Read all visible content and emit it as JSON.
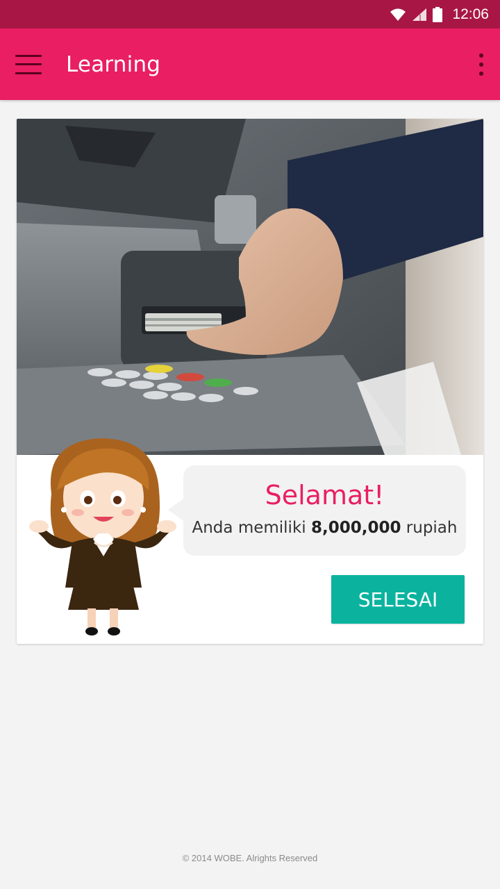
{
  "status_bar": {
    "time": "12:06",
    "icons": [
      "wifi-icon",
      "signal-icon",
      "battery-icon"
    ]
  },
  "app_bar": {
    "title": "Learning",
    "menu_icon": "hamburger-menu-icon",
    "overflow_icon": "more-vert-icon"
  },
  "card": {
    "hero_image": "atm-cash-withdrawal-photo",
    "character_image": "cartoon-businesswoman",
    "bubble": {
      "title": "Selamat!",
      "text_prefix": "Anda memiliki",
      "amount": "8,000,000",
      "text_suffix": "rupiah"
    },
    "button_label": "SELESAI"
  },
  "footer": {
    "copyright": "© 2014 WOBE. Alrights Reserved"
  },
  "colors": {
    "status_bar": "#a81646",
    "app_bar": "#e91e63",
    "accent": "#e91e63",
    "button": "#0bb39f",
    "background": "#f3f3f3"
  }
}
